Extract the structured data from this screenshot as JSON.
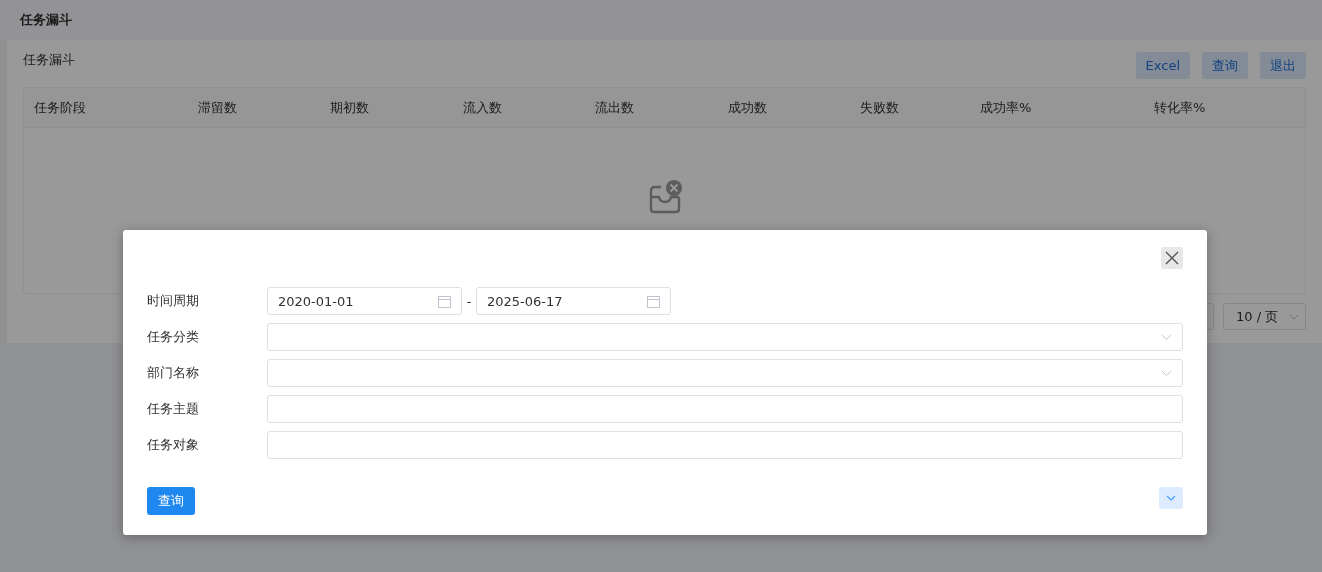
{
  "page_title": "任务漏斗",
  "panel": {
    "title": "任务漏斗",
    "buttons": [
      "Excel",
      "查询",
      "退出"
    ],
    "table": {
      "columns": [
        "任务阶段",
        "滞留数",
        "期初数",
        "流入数",
        "流出数",
        "成功数",
        "失败数",
        "成功率%",
        "转化率%"
      ]
    },
    "pagination": {
      "page_size": "10 / 页"
    }
  },
  "dialog": {
    "fields": [
      {
        "label": "时间周期",
        "kind": "date_range",
        "from": "2020-01-01",
        "separator": "-",
        "to": "2025-06-17"
      },
      {
        "label": "任务分类",
        "kind": "select"
      },
      {
        "label": "部门名称",
        "kind": "select"
      },
      {
        "label": "任务主题",
        "kind": "text"
      },
      {
        "label": "任务对象",
        "kind": "text"
      }
    ],
    "submit": "查询"
  }
}
